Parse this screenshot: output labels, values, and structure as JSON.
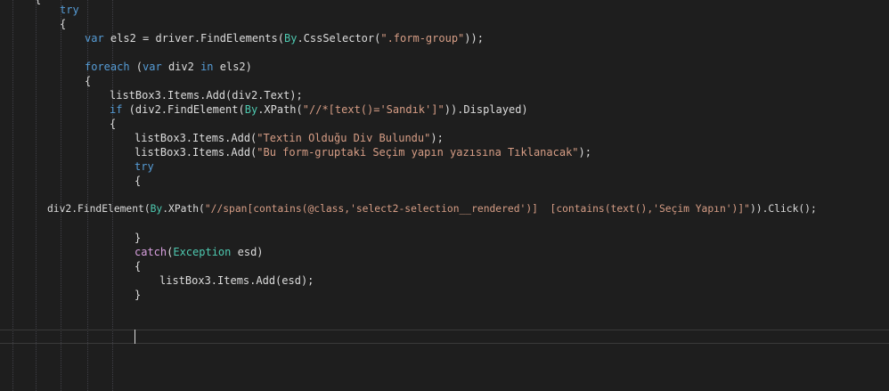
{
  "editor": {
    "lines": [
      [
        {
          "t": "{",
          "c": "plain"
        }
      ],
      [
        {
          "t": "try",
          "c": "kw"
        }
      ],
      [
        {
          "t": "{",
          "c": "plain"
        }
      ],
      [
        {
          "t": "var",
          "c": "kw"
        },
        {
          "t": " els2 = driver.FindElements(",
          "c": "plain"
        },
        {
          "t": "By",
          "c": "typ"
        },
        {
          "t": ".CssSelector(",
          "c": "plain"
        },
        {
          "t": "\".form-group\"",
          "c": "str"
        },
        {
          "t": "));",
          "c": "plain"
        }
      ],
      [
        {
          "t": "foreach",
          "c": "kw"
        },
        {
          "t": " (",
          "c": "plain"
        },
        {
          "t": "var",
          "c": "kw"
        },
        {
          "t": " div2 ",
          "c": "plain"
        },
        {
          "t": "in",
          "c": "kw"
        },
        {
          "t": " els2)",
          "c": "plain"
        }
      ],
      [
        {
          "t": "{",
          "c": "plain"
        }
      ],
      [
        {
          "t": "listBox3.Items.Add(div2.Text);",
          "c": "plain"
        }
      ],
      [
        {
          "t": "if",
          "c": "kw"
        },
        {
          "t": " (div2.FindElement(",
          "c": "plain"
        },
        {
          "t": "By",
          "c": "typ"
        },
        {
          "t": ".XPath(",
          "c": "plain"
        },
        {
          "t": "\"//*[text()='Sandık']\"",
          "c": "str"
        },
        {
          "t": ")).Displayed)",
          "c": "plain"
        }
      ],
      [
        {
          "t": "{",
          "c": "plain"
        }
      ],
      [
        {
          "t": "listBox3.Items.Add(",
          "c": "plain"
        },
        {
          "t": "\"Textin Olduğu Div Bulundu\"",
          "c": "str"
        },
        {
          "t": ");",
          "c": "plain"
        }
      ],
      [
        {
          "t": "listBox3.Items.Add(",
          "c": "plain"
        },
        {
          "t": "\"Bu form-gruptaki Seçim yapın yazısına Tıklanacak\"",
          "c": "str"
        },
        {
          "t": ");",
          "c": "plain"
        }
      ],
      [
        {
          "t": "try",
          "c": "kw"
        }
      ],
      [
        {
          "t": "{",
          "c": "plain"
        }
      ],
      [
        {
          "t": "div2.FindElement(",
          "c": "plain"
        },
        {
          "t": "By",
          "c": "typ"
        },
        {
          "t": ".XPath(",
          "c": "plain"
        },
        {
          "t": "\"//span[contains(@class,'select2-selection__rendered')]  [contains(text(),'Seçim Yapın')]\"",
          "c": "str"
        },
        {
          "t": ")).Click();",
          "c": "plain"
        }
      ],
      [
        {
          "t": "}",
          "c": "plain"
        }
      ],
      [
        {
          "t": "catch",
          "c": "ctl"
        },
        {
          "t": "(",
          "c": "plain"
        },
        {
          "t": "Exception",
          "c": "typ"
        },
        {
          "t": " esd)",
          "c": "plain"
        }
      ],
      [
        {
          "t": "{",
          "c": "plain"
        }
      ],
      [
        {
          "t": "listBox3.Items.Add(esd);",
          "c": "plain"
        }
      ],
      [
        {
          "t": "}",
          "c": "plain"
        }
      ]
    ]
  },
  "colors": {
    "background": "#1e1e1e",
    "keyword": "#569cd6",
    "control_keyword": "#d8a0df",
    "string": "#d69d85",
    "type": "#4ec9b0",
    "text": "#dcdcdc"
  }
}
